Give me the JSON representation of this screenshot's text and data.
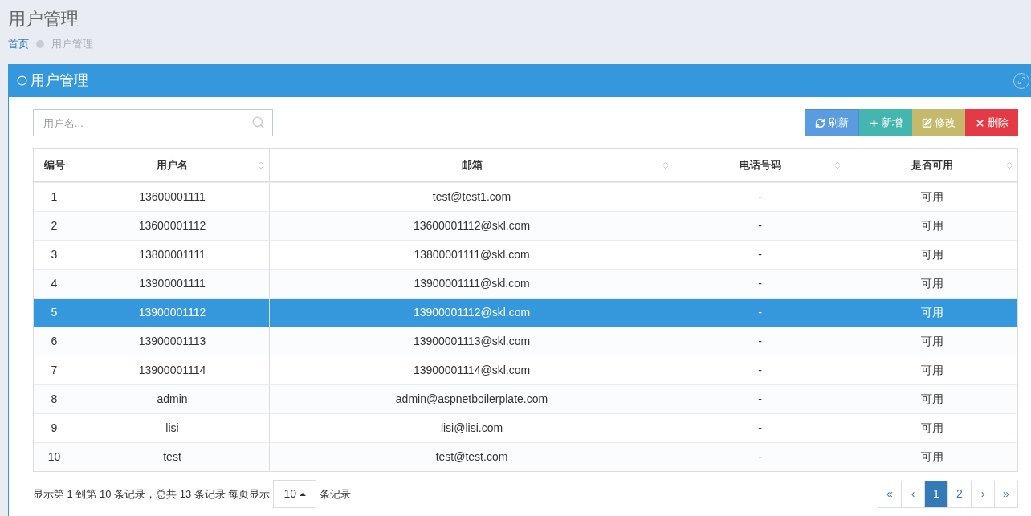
{
  "page_title": "用户管理",
  "breadcrumb": [
    {
      "label": "首页",
      "selected": false
    },
    {
      "label": "用户管理",
      "selected": true
    }
  ],
  "panel": {
    "title": "用户管理"
  },
  "search": {
    "placeholder": "用户名..."
  },
  "buttons": [
    {
      "kind": "refresh",
      "label": "刷新"
    },
    {
      "kind": "add",
      "label": "新增"
    },
    {
      "kind": "edit",
      "label": "修改"
    },
    {
      "kind": "delete",
      "label": "删除"
    }
  ],
  "table": {
    "columns": [
      {
        "label": "编号",
        "sortable": false
      },
      {
        "label": "用户名",
        "sortable": true
      },
      {
        "label": "邮箱",
        "sortable": true
      },
      {
        "label": "电话号码",
        "sortable": true
      },
      {
        "label": "是否可用",
        "sortable": true
      }
    ],
    "rows": [
      {
        "cells": [
          "1",
          "13600001111",
          "test@test1.com",
          "-",
          "可用"
        ],
        "selected": false
      },
      {
        "cells": [
          "2",
          "13600001112",
          "13600001112@skl.com",
          "-",
          "可用"
        ],
        "selected": false
      },
      {
        "cells": [
          "3",
          "13800001111",
          "13800001111@skl.com",
          "-",
          "可用"
        ],
        "selected": false
      },
      {
        "cells": [
          "4",
          "13900001111",
          "13900001111@skl.com",
          "-",
          "可用"
        ],
        "selected": false
      },
      {
        "cells": [
          "5",
          "13900001112",
          "13900001112@skl.com",
          "-",
          "可用"
        ],
        "selected": true
      },
      {
        "cells": [
          "6",
          "13900001113",
          "13900001113@skl.com",
          "-",
          "可用"
        ],
        "selected": false
      },
      {
        "cells": [
          "7",
          "13900001114",
          "13900001114@skl.com",
          "-",
          "可用"
        ],
        "selected": false
      },
      {
        "cells": [
          "8",
          "admin",
          "admin@aspnetboilerplate.com",
          "-",
          "可用"
        ],
        "selected": false
      },
      {
        "cells": [
          "9",
          "lisi",
          "lisi@lisi.com",
          "-",
          "可用"
        ],
        "selected": false
      },
      {
        "cells": [
          "10",
          "test",
          "test@test.com",
          "-",
          "可用"
        ],
        "selected": false
      }
    ]
  },
  "footer": {
    "summary": "显示第 1 到第 10 条记录，总共 13 条记录 每页显示",
    "page_size": "10",
    "suffix": "条记录"
  },
  "pagination": [
    {
      "label": "«",
      "selected": false
    },
    {
      "label": "‹",
      "selected": false
    },
    {
      "label": "1",
      "selected": true
    },
    {
      "label": "2",
      "selected": false
    },
    {
      "label": "›",
      "selected": false
    },
    {
      "label": "»",
      "selected": false
    }
  ]
}
